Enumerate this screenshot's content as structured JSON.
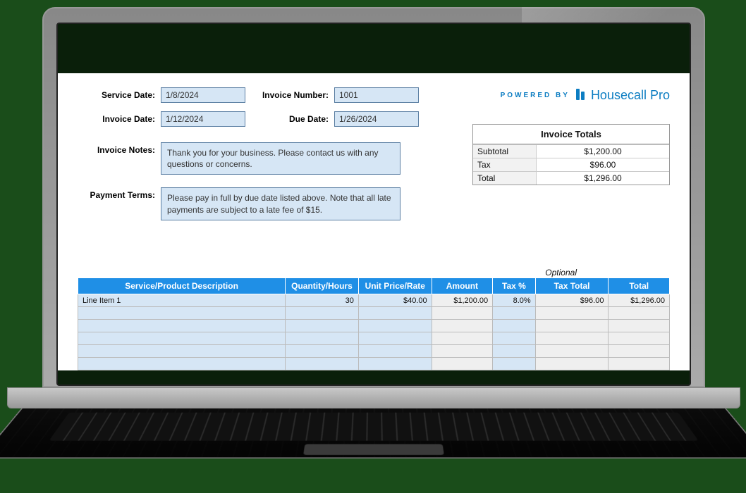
{
  "meta": {
    "service_date_label": "Service Date:",
    "service_date": "1/8/2024",
    "invoice_number_label": "Invoice Number:",
    "invoice_number": "1001",
    "invoice_date_label": "Invoice Date:",
    "invoice_date": "1/12/2024",
    "due_date_label": "Due Date:",
    "due_date": "1/26/2024",
    "invoice_notes_label": "Invoice Notes:",
    "invoice_notes": "Thank you for your business. Please contact us with any questions or concerns.",
    "payment_terms_label": "Payment Terms:",
    "payment_terms": "Please pay in full by due date listed above. Note that all late payments are subject to a late fee of $15."
  },
  "branding": {
    "powered_by": "POWERED BY",
    "name": "Housecall Pro"
  },
  "totals": {
    "header": "Invoice Totals",
    "subtotal_label": "Subtotal",
    "subtotal": "$1,200.00",
    "tax_label": "Tax",
    "tax": "$96.00",
    "total_label": "Total",
    "total": "$1,296.00"
  },
  "table": {
    "optional_label": "Optional",
    "headers": {
      "desc": "Service/Product Description",
      "qty": "Quantity/Hours",
      "rate": "Unit Price/Rate",
      "amount": "Amount",
      "taxpct": "Tax %",
      "taxtotal": "Tax Total",
      "total": "Total"
    },
    "row1": {
      "desc": "Line Item 1",
      "qty": "30",
      "rate": "$40.00",
      "amount": "$1,200.00",
      "taxpct": "8.0%",
      "taxtotal": "$96.00",
      "total": "$1,296.00"
    }
  }
}
